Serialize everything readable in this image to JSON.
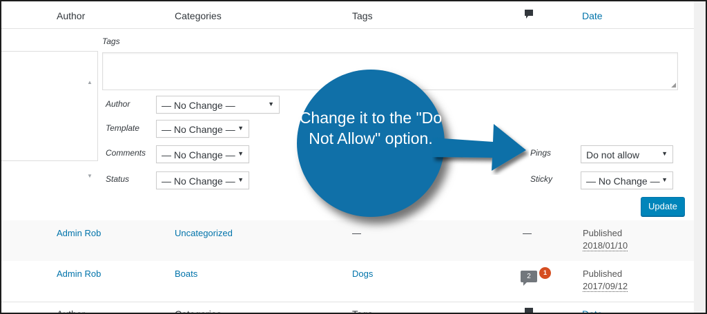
{
  "header": {
    "author": "Author",
    "categories": "Categories",
    "tags": "Tags",
    "comment_icon": "comment-bubble-icon",
    "date": "Date"
  },
  "bulk_edit": {
    "tags_label": "Tags",
    "tags_value": "",
    "fields": {
      "author": {
        "label": "Author",
        "value": "— No Change —"
      },
      "template": {
        "label": "Template",
        "value": "— No Change —"
      },
      "comments": {
        "label": "Comments",
        "value": "— No Change —"
      },
      "status": {
        "label": "Status",
        "value": "— No Change —"
      },
      "pings": {
        "label": "Pings",
        "value": "Do not allow"
      },
      "sticky": {
        "label": "Sticky",
        "value": "— No Change —"
      }
    },
    "update_label": "Update"
  },
  "callout": {
    "text": "Change it to the \"Do Not Allow\" option.",
    "color": "#1070a8"
  },
  "rows": [
    {
      "author": "Admin Rob",
      "categories": "Uncategorized",
      "tags": "—",
      "comments": "—",
      "status": "Published",
      "date": "2018/01/10"
    },
    {
      "author": "Admin Rob",
      "categories": "Boats",
      "tags": "Dogs",
      "comments_approved": "2",
      "comments_pending": "1",
      "status": "Published",
      "date": "2017/09/12"
    }
  ],
  "footer": {
    "author": "Author",
    "categories": "Categories",
    "tags": "Tags",
    "date": "Date"
  },
  "colors": {
    "link": "#0073aa",
    "button": "#0085ba",
    "badge": "#d54e21"
  }
}
